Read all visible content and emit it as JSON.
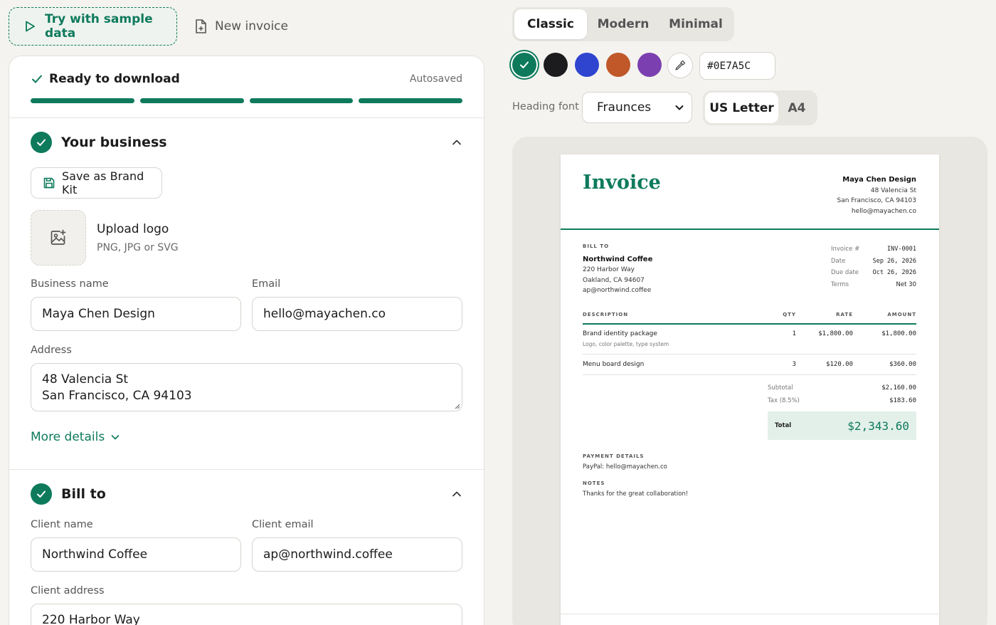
{
  "toolbar": {
    "sample_label": "Try with sample data",
    "new_invoice_label": "New invoice"
  },
  "status": {
    "ready_label": "Ready to download",
    "autosaved": "Autosaved",
    "progress_steps_complete": 4,
    "progress_steps_total": 4
  },
  "business": {
    "title": "Your business",
    "brand_kit_label": "Save as Brand Kit",
    "upload_title": "Upload logo",
    "upload_sub": "PNG, JPG or SVG",
    "name_label": "Business name",
    "name_value": "Maya Chen Design",
    "email_label": "Email",
    "email_value": "hello@mayachen.co",
    "address_label": "Address",
    "address_line1": "48 Valencia St",
    "address_line2": "San Francisco, CA 94103",
    "more_details": "More details"
  },
  "billto": {
    "title": "Bill to",
    "client_name_label": "Client name",
    "client_name_value": "Northwind Coffee",
    "client_email_label": "Client email",
    "client_email_value": "ap@northwind.coffee",
    "client_address_label": "Client address",
    "client_address_line1": "220 Harbor Way"
  },
  "templates": {
    "options": [
      "Classic",
      "Modern",
      "Minimal"
    ],
    "selected": "Classic"
  },
  "colors": {
    "swatches": [
      "#0E7A5C",
      "#1c1c1e",
      "#2f45d0",
      "#c0582a",
      "#7b3fb0"
    ],
    "selected": "#0E7A5C",
    "hex_value": "#0E7A5C",
    "icons": [
      "check-icon",
      "eyedropper-icon"
    ]
  },
  "font": {
    "label": "Heading font",
    "value": "Fraunces"
  },
  "paper_size": {
    "options": [
      "US Letter",
      "A4"
    ],
    "selected": "US Letter"
  },
  "invoice": {
    "title": "Invoice",
    "from_name": "Maya Chen Design",
    "from_line1": "48 Valencia St",
    "from_line2": "San Francisco, CA 94103",
    "from_email": "hello@mayachen.co",
    "bill_to_heading": "BILL TO",
    "to_name": "Northwind Coffee",
    "to_line1": "220 Harbor Way",
    "to_line2": "Oakland, CA 94607",
    "to_email": "ap@northwind.coffee",
    "meta": [
      {
        "k": "Invoice #",
        "v": "INV-0001"
      },
      {
        "k": "Date",
        "v": "Sep 26, 2026"
      },
      {
        "k": "Due date",
        "v": "Oct 26, 2026"
      },
      {
        "k": "Terms",
        "v": "Net 30"
      }
    ],
    "columns": {
      "description": "DESCRIPTION",
      "qty": "QTY",
      "rate": "RATE",
      "amount": "AMOUNT"
    },
    "items": [
      {
        "description": "Brand identity package",
        "sub": "Logo, color palette, type system",
        "qty": "1",
        "rate": "$1,800.00",
        "amount": "$1,800.00"
      },
      {
        "description": "Menu board design",
        "sub": "",
        "qty": "3",
        "rate": "$120.00",
        "amount": "$360.00"
      }
    ],
    "subtotal_label": "Subtotal",
    "subtotal": "$2,160.00",
    "tax_label": "Tax (8.5%)",
    "tax": "$183.60",
    "total_label": "Total",
    "total": "$2,343.60",
    "payment_heading": "PAYMENT DETAILS",
    "payment_text": "PayPal: hello@mayachen.co",
    "notes_heading": "NOTES",
    "notes_text": "Thanks for the great collaboration!"
  }
}
